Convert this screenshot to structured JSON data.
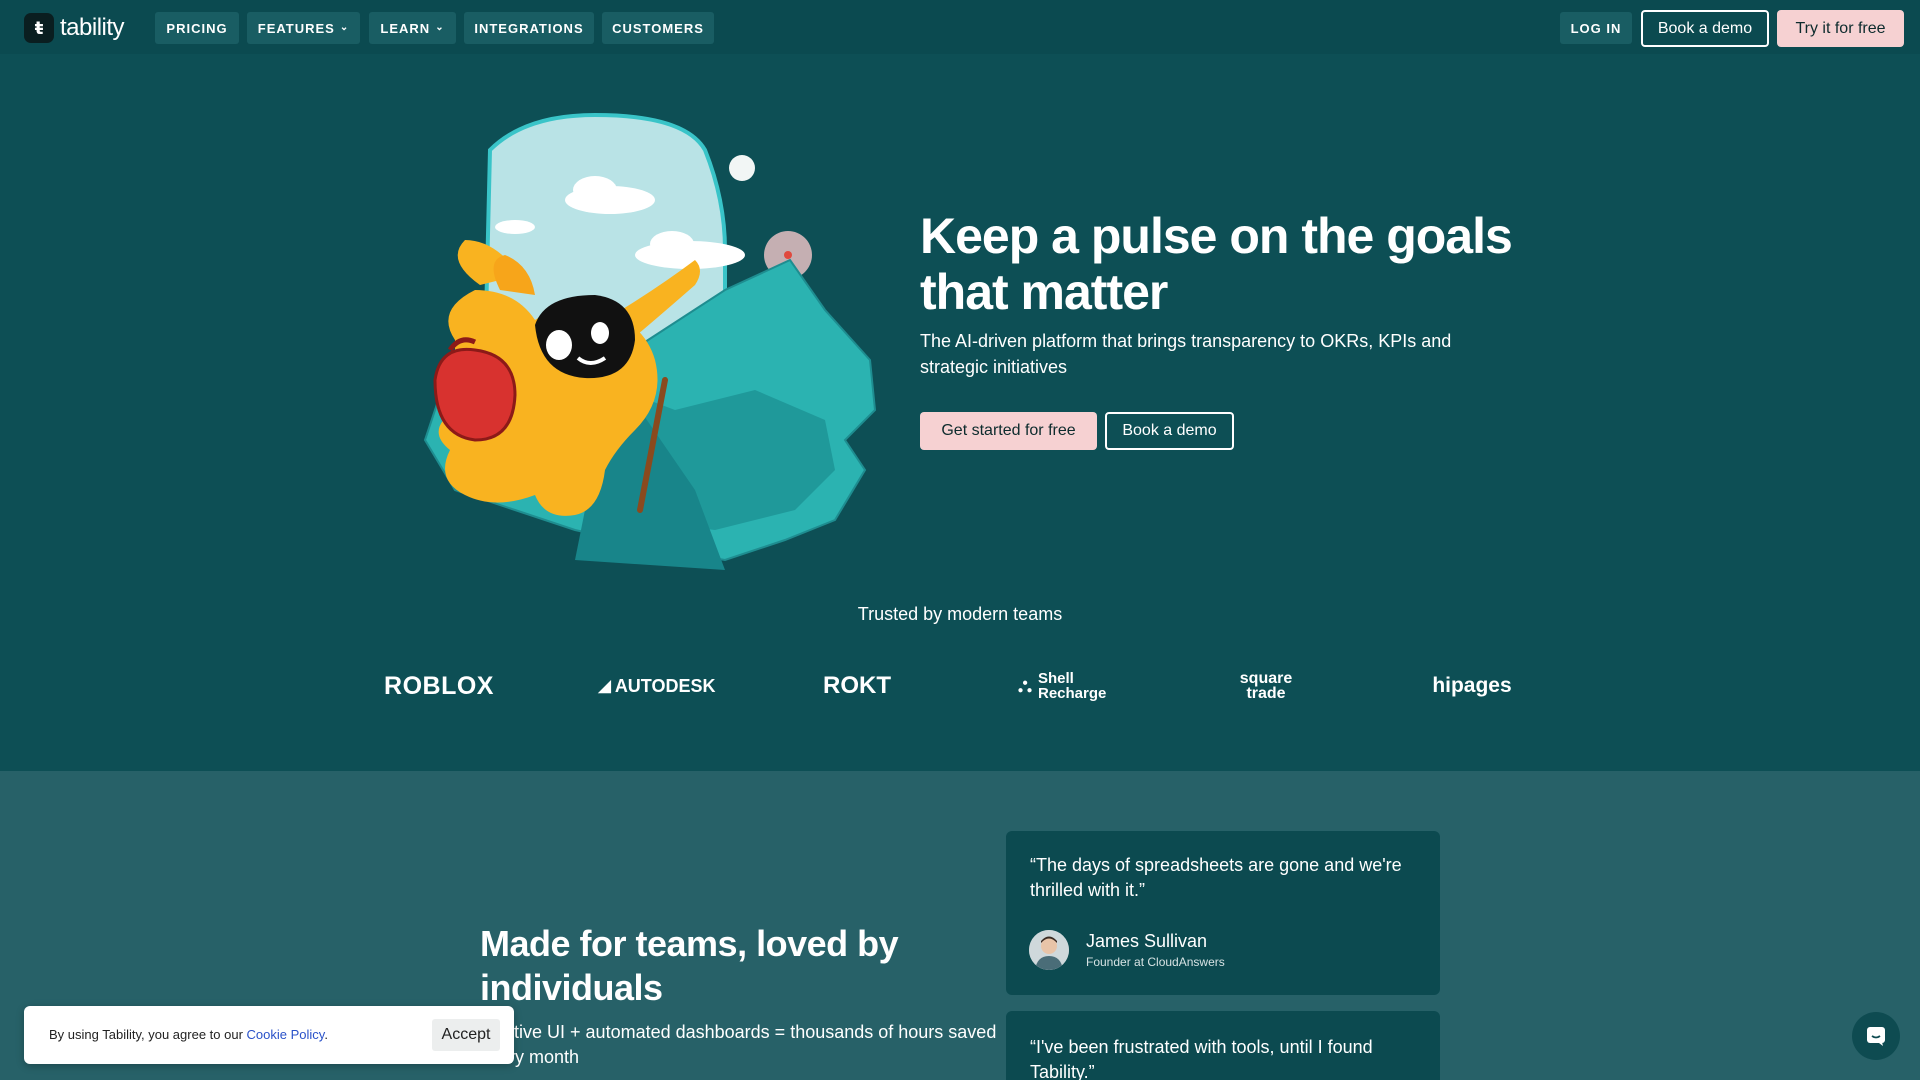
{
  "brand": {
    "name": "tability",
    "mark": "ŧ"
  },
  "nav": {
    "items": [
      {
        "label": "PRICING"
      },
      {
        "label": "FEATURES"
      },
      {
        "label": "LEARN"
      },
      {
        "label": "INTEGRATIONS"
      },
      {
        "label": "CUSTOMERS"
      }
    ],
    "login": "LOG IN",
    "book_demo": "Book a demo",
    "try_free": "Try it for free"
  },
  "hero": {
    "title": "Keep a pulse on the goals that matter",
    "subtitle": "The AI-driven platform that brings transparency to OKRs, KPIs and strategic initiatives",
    "cta_primary": "Get started for free",
    "cta_secondary": "Book a demo"
  },
  "trusted": {
    "heading": "Trusted by modern teams",
    "logos": [
      "ROBLOX",
      "AUTODESK",
      "ROKT",
      "Shell Recharge",
      "square trade",
      "hipages"
    ]
  },
  "section2": {
    "title": "Made for teams, loved by individuals",
    "subtitle": "Intuitive UI + automated dashboards = thousands of hours saved every month"
  },
  "testimonials": [
    {
      "quote": "“The days of spreadsheets are gone and we're thrilled with it.”",
      "name": "James Sullivan",
      "role": "Founder at CloudAnswers"
    },
    {
      "quote": "“I've been frustrated with tools, until I found Tability.”"
    }
  ],
  "cookie": {
    "text": "By using Tability, you agree to our ",
    "link": "Cookie Policy",
    "period": ".",
    "accept": "Accept"
  },
  "colors": {
    "background": "#0d4f55",
    "nav": "#0b4a50",
    "section2": "#276168",
    "card": "#0c4a50",
    "pink": "#f6d1d2"
  }
}
